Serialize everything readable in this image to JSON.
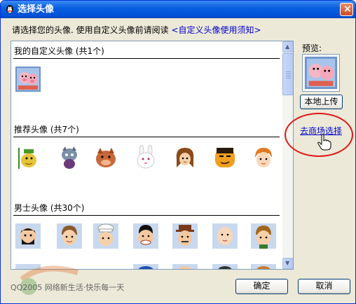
{
  "window": {
    "title": "选择头像",
    "close_label": "×"
  },
  "instruction": {
    "text": "请选择您的头像. 使用自定义头像前请阅读",
    "link": "<自定义头像使用须知>"
  },
  "sections": [
    {
      "title": "我的自定义头像 (共1个)"
    },
    {
      "title": "推荐头像 (共7个)"
    },
    {
      "title": "男士头像 (共30个)"
    }
  ],
  "preview": {
    "label": "预览:"
  },
  "buttons": {
    "upload": "本地上传",
    "ok": "确定",
    "cancel": "取消"
  },
  "mall_link": "去商场选择",
  "footer": {
    "text": "QQ2005  网络新生活·快乐每一天"
  },
  "colors": {
    "title_bar": "#0a5fe0",
    "link": "#0000cc",
    "highlight_circle": "#e01818"
  }
}
